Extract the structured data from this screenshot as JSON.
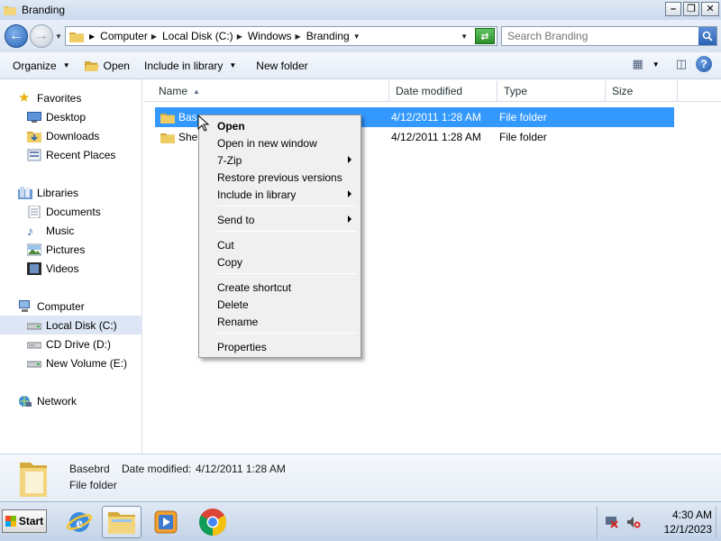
{
  "window": {
    "title": "Branding"
  },
  "address": {
    "crumbs": [
      "Computer",
      "Local Disk (C:)",
      "Windows",
      "Branding"
    ]
  },
  "search": {
    "placeholder": "Search Branding"
  },
  "toolbar": {
    "organize": "Organize",
    "open": "Open",
    "include_in_library": "Include in library",
    "new_folder": "New folder"
  },
  "nav": {
    "favorites": {
      "label": "Favorites",
      "items": [
        "Desktop",
        "Downloads",
        "Recent Places"
      ]
    },
    "libraries": {
      "label": "Libraries",
      "items": [
        "Documents",
        "Music",
        "Pictures",
        "Videos"
      ]
    },
    "computer": {
      "label": "Computer",
      "items": [
        "Local Disk (C:)",
        "CD Drive (D:)",
        "New Volume (E:)"
      ]
    },
    "network": {
      "label": "Network"
    }
  },
  "columns": [
    "Name",
    "Date modified",
    "Type",
    "Size"
  ],
  "files": [
    {
      "name": "Basebrd",
      "visible_name": "Bas",
      "date": "4/12/2011 1:28 AM",
      "type": "File folder",
      "selected": true
    },
    {
      "name": "ShellBrd",
      "visible_name": "Shel",
      "date": "4/12/2011 1:28 AM",
      "type": "File folder",
      "selected": false
    }
  ],
  "context_menu": {
    "items": [
      {
        "label": "Open",
        "bold": true,
        "submenu": false
      },
      {
        "label": "Open in new window",
        "submenu": false
      },
      {
        "label": "7-Zip",
        "submenu": true
      },
      {
        "label": "Restore previous versions",
        "submenu": false
      },
      {
        "label": "Include in library",
        "submenu": true
      },
      {
        "label": "Send to",
        "submenu": true
      },
      {
        "label": "Cut",
        "submenu": false
      },
      {
        "label": "Copy",
        "submenu": false
      },
      {
        "label": "Create shortcut",
        "submenu": false
      },
      {
        "label": "Delete",
        "submenu": false
      },
      {
        "label": "Rename",
        "submenu": false
      },
      {
        "label": "Properties",
        "submenu": false
      }
    ]
  },
  "details": {
    "name": "Basebrd",
    "date_label": "Date modified:",
    "date_value": "4/12/2011 1:28 AM",
    "type": "File folder"
  },
  "taskbar": {
    "start_label": "Start",
    "clock_time": "4:30 AM",
    "clock_date": "12/1/2023"
  },
  "colors": {
    "selection": "#3399ff",
    "titlebar": "#c9d9ee",
    "menu_bg": "#f0f0f0"
  }
}
